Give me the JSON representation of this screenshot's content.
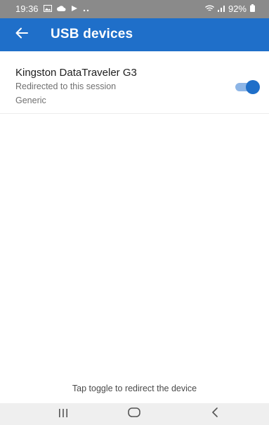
{
  "status_bar": {
    "time": "19:36",
    "battery_percent": "92%",
    "left_icons": [
      "gallery-icon",
      "cloud-icon",
      "play-icon",
      "more-dots-icon"
    ],
    "right_icons": [
      "wifi-icon",
      "signal-icon",
      "battery-icon"
    ]
  },
  "app_bar": {
    "title": "USB devices",
    "back_icon": "back-arrow-icon",
    "background_color": "#1f6fc9"
  },
  "devices": [
    {
      "name": "Kingston DataTraveler G3",
      "status": "Redirected to this session",
      "type": "Generic",
      "redirect_enabled": true
    }
  ],
  "footer": {
    "hint": "Tap toggle to redirect the device"
  },
  "navigation": {
    "buttons": [
      "recent-apps-icon",
      "home-icon",
      "back-icon"
    ]
  },
  "colors": {
    "accent": "#1f6fc9",
    "toggle_track": "#8db5e6",
    "status_bar": "#8a8a8a",
    "nav_bar": "#efefef"
  }
}
